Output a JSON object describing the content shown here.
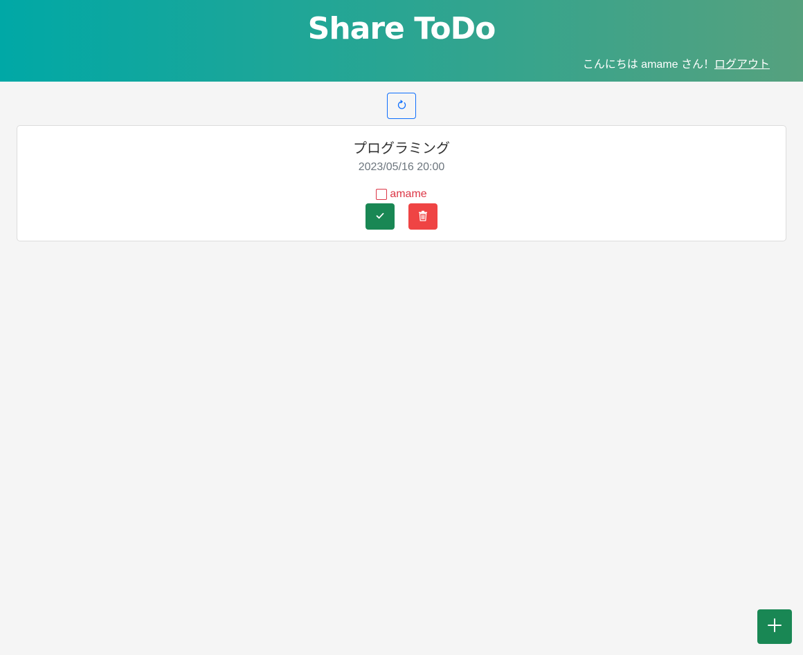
{
  "header": {
    "title": "Share ToDo",
    "greeting": "こんにちは amame さん！",
    "logout_label": "ログアウト"
  },
  "toolbar": {
    "refresh_icon": "refresh-icon"
  },
  "tasks": [
    {
      "title": "プログラミング",
      "datetime": "2023/05/16 20:00",
      "assignee": "amame",
      "assignee_checked": false,
      "complete_icon": "check-icon",
      "delete_icon": "trash-icon"
    }
  ],
  "fab": {
    "icon": "plus-icon"
  },
  "colors": {
    "header_gradient_start": "#00a8a6",
    "header_gradient_end": "#56a17e",
    "primary_outline": "#0d6efd",
    "success": "#198754",
    "danger": "#ef4444",
    "assignee_text": "#dc3545"
  }
}
